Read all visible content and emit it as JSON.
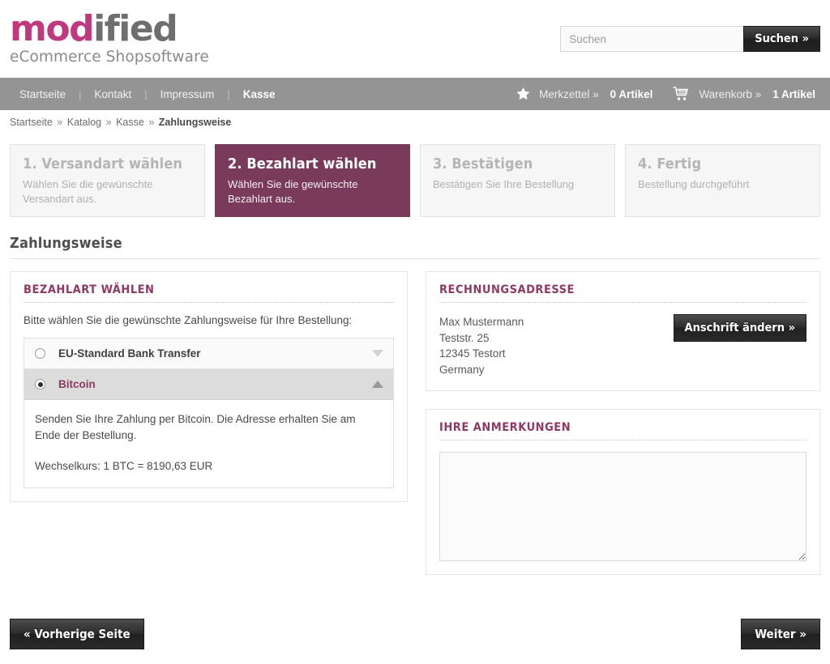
{
  "brand": {
    "logo_primary": "mod",
    "logo_secondary": "ified",
    "logo_tagline": "eCommerce Shopsoftware",
    "accent_color": "#8e3a63",
    "logo_pink": "#c0397f",
    "active_step_color": "#7a3a5c",
    "navbar_color": "#949494"
  },
  "search": {
    "placeholder": "Suchen",
    "value": "",
    "button_label": "Suchen »"
  },
  "nav": {
    "items": [
      {
        "label": "Startseite",
        "active": false
      },
      {
        "label": "Kontakt",
        "active": false
      },
      {
        "label": "Impressum",
        "active": false
      },
      {
        "label": "Kasse",
        "active": true
      }
    ],
    "separator": "|",
    "wishlist": {
      "icon": "star-icon",
      "label": "Merkzettel »",
      "count": "0 Artikel"
    },
    "cart": {
      "icon": "cart-icon",
      "label": "Warenkorb »",
      "count": "1 Artikel"
    }
  },
  "breadcrumb": {
    "items": [
      "Startseite",
      "Katalog",
      "Kasse",
      "Zahlungsweise"
    ],
    "separator": "»"
  },
  "steps": [
    {
      "title": "1. Versandart wählen",
      "desc": "Wählen Sie die gewünschte Versandart aus.",
      "active": false
    },
    {
      "title": "2. Bezahlart wählen",
      "desc": "Wählen Sie die gewünschte Bezahlart aus.",
      "active": true
    },
    {
      "title": "3. Bestätigen",
      "desc": "Bestätigen Sie Ihre Bestellung",
      "active": false
    },
    {
      "title": "4. Fertig",
      "desc": "Bestellung durchgeführt",
      "active": false
    }
  ],
  "page_heading": "Zahlungsweise",
  "payment": {
    "panel_title": "Bezahlart wählen",
    "intro": "Bitte wählen Sie die gewünschte Zahlungsweise für Ihre Bestellung:",
    "options": [
      {
        "label": "EU-Standard Bank Transfer",
        "selected": false,
        "chevron": "chevron-down-icon"
      },
      {
        "label": "Bitcoin",
        "selected": true,
        "chevron": "chevron-up-icon"
      }
    ],
    "detail_text": "Senden Sie Ihre Zahlung per Bitcoin. Die Adresse erhalten Sie am Ende der Bestellung.",
    "detail_rate": "Wechselkurs: 1 BTC = 8190,63 EUR"
  },
  "billing": {
    "panel_title": "Rechnungsadresse",
    "name": "Max Mustermann",
    "street": "Teststr. 25",
    "city": "12345 Testort",
    "country": "Germany",
    "change_button": "Anschrift ändern »"
  },
  "notes": {
    "panel_title": "Ihre Anmerkungen",
    "value": "",
    "placeholder": ""
  },
  "footer": {
    "prev_button": "« Vorherige Seite",
    "next_button": "Weiter »"
  }
}
